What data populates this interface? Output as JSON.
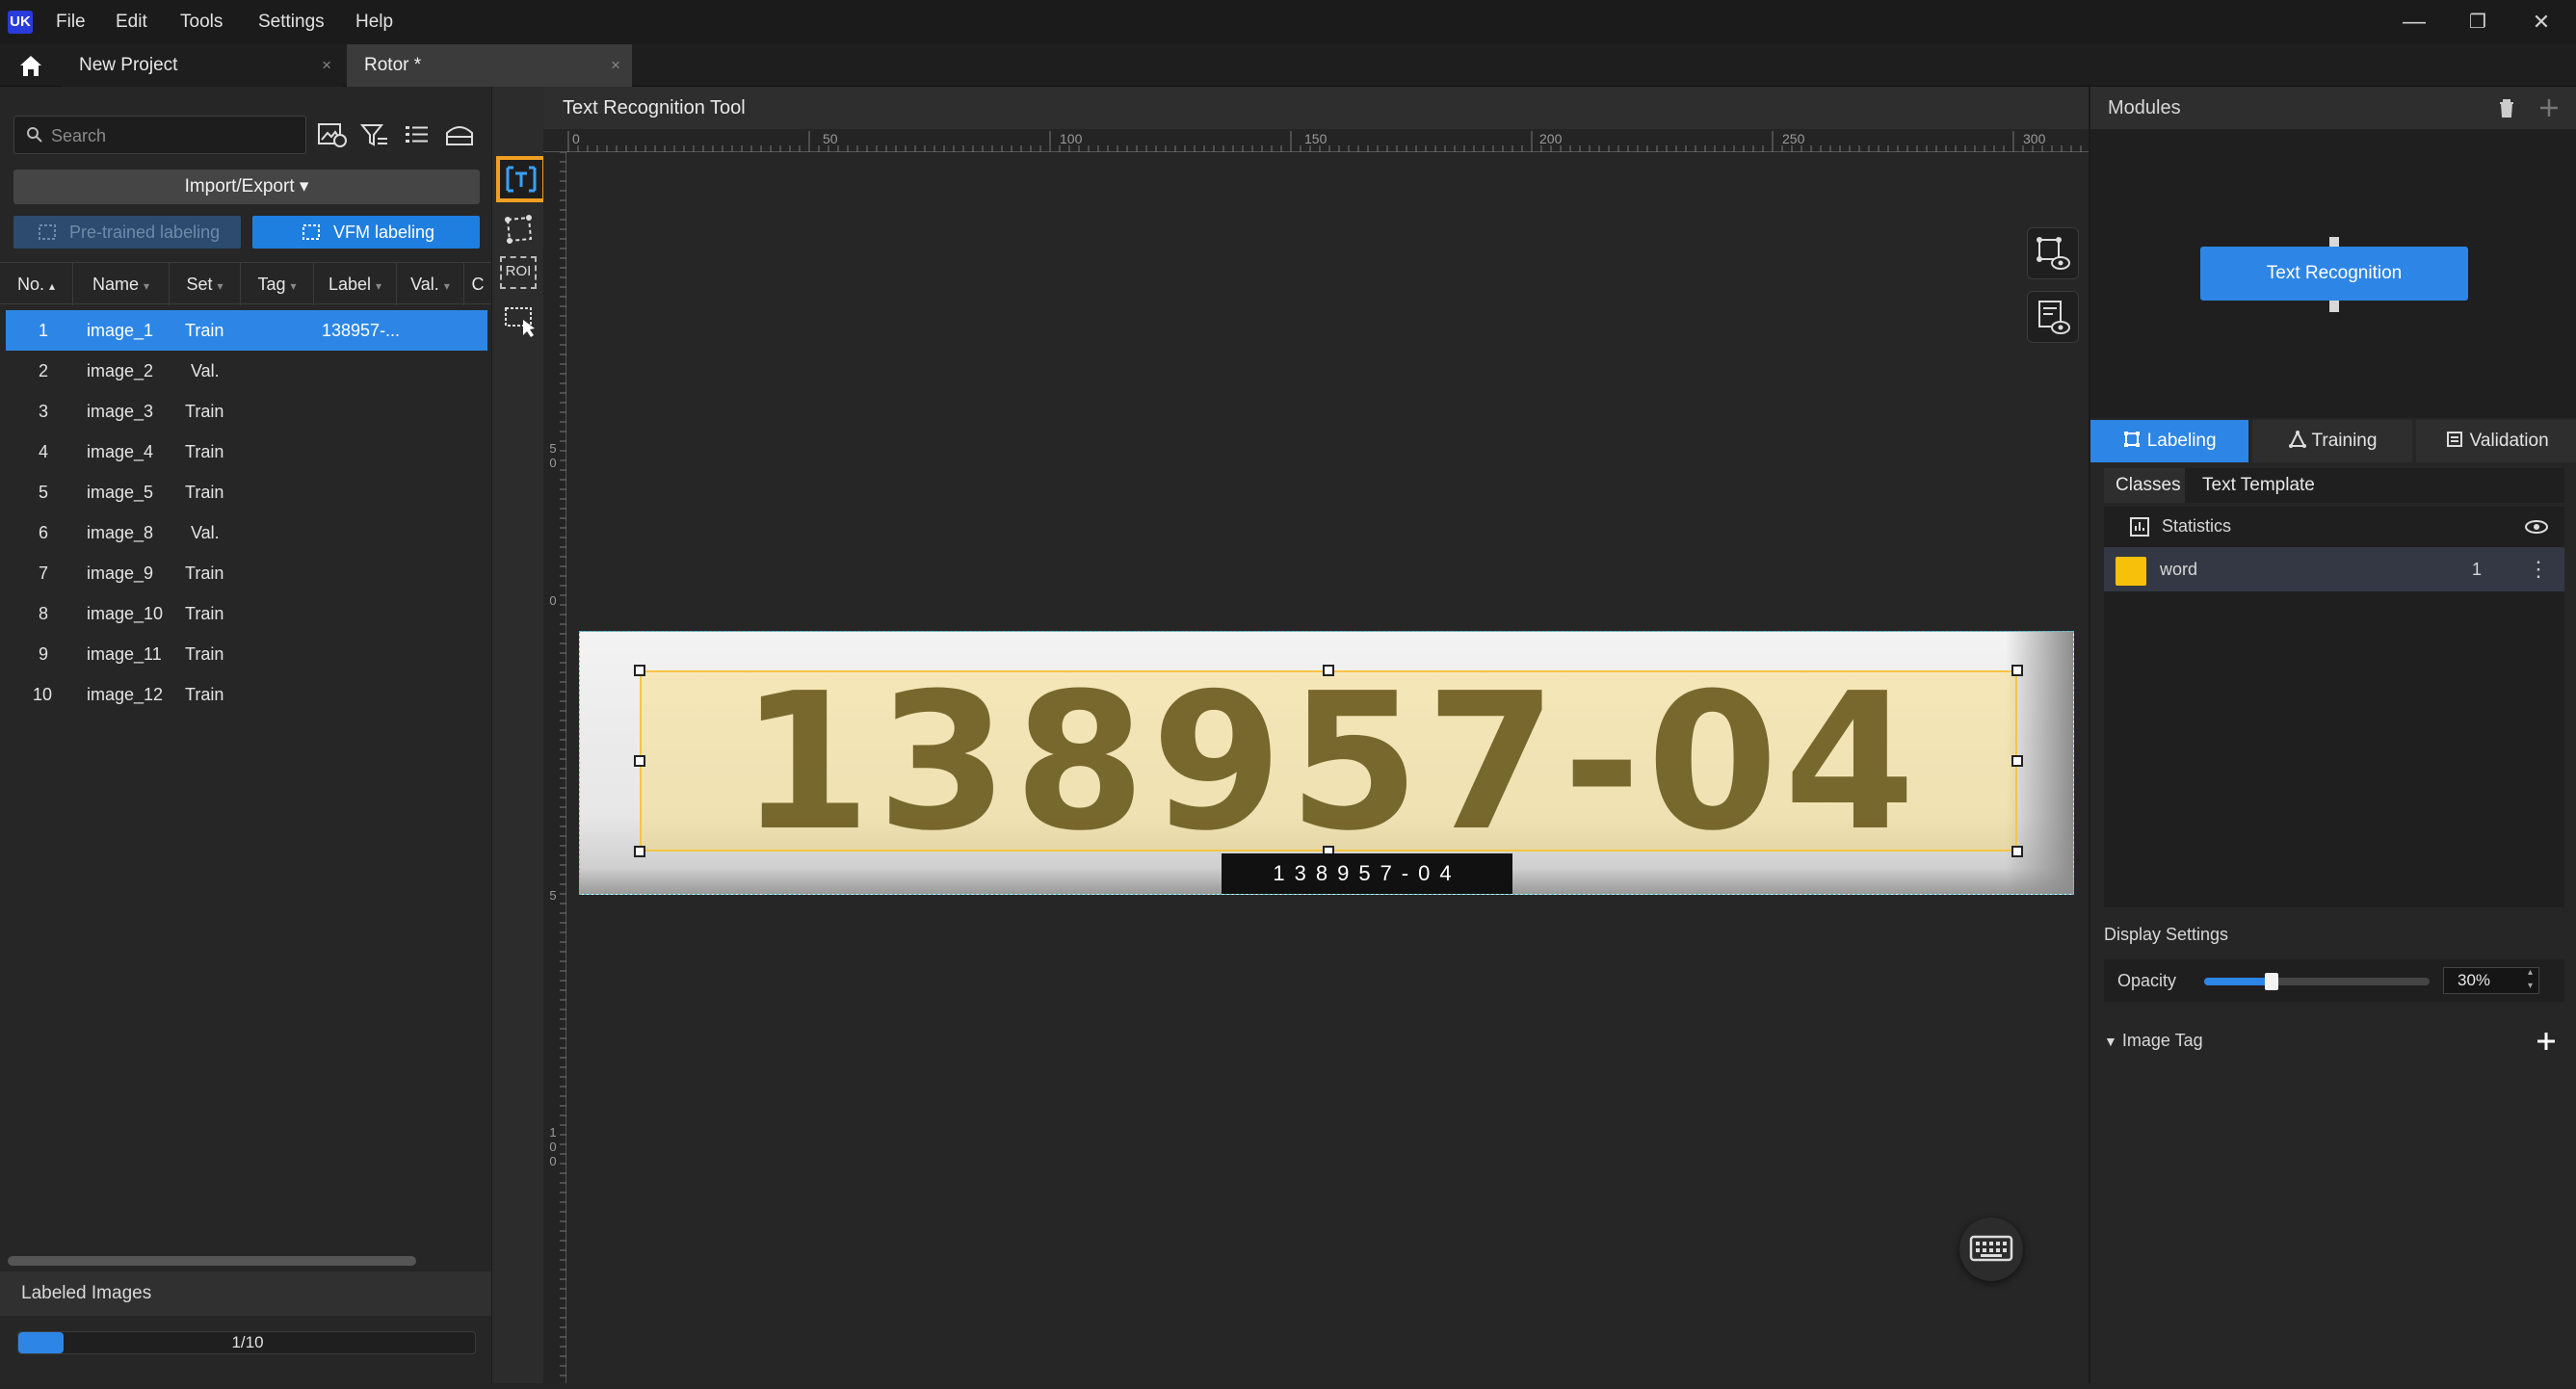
{
  "app": {
    "logo_text": "UK"
  },
  "menu": [
    "File",
    "Edit",
    "Tools",
    "Settings",
    "Help"
  ],
  "window_controls": {
    "minimize": "—",
    "restore": "❐",
    "close": "✕"
  },
  "tabs": [
    {
      "label": "New Project",
      "close": "×"
    },
    {
      "label": "Rotor *",
      "close": "×"
    }
  ],
  "left": {
    "search_placeholder": "Search",
    "import_export_label": "Import/Export",
    "import_export_caret": "▾",
    "pretrained_label": "Pre-trained labeling",
    "vfm_label": "VFM labeling",
    "columns": [
      "No.",
      "Name",
      "Set",
      "Tag",
      "Label",
      "Val.",
      "C"
    ],
    "rows": [
      {
        "no": "1",
        "name": "image_1",
        "set": "Train",
        "label": "138957-..."
      },
      {
        "no": "2",
        "name": "image_2",
        "set": "Val.",
        "label": ""
      },
      {
        "no": "3",
        "name": "image_3",
        "set": "Train",
        "label": ""
      },
      {
        "no": "4",
        "name": "image_4",
        "set": "Train",
        "label": ""
      },
      {
        "no": "5",
        "name": "image_5",
        "set": "Train",
        "label": ""
      },
      {
        "no": "6",
        "name": "image_8",
        "set": "Val.",
        "label": ""
      },
      {
        "no": "7",
        "name": "image_9",
        "set": "Train",
        "label": ""
      },
      {
        "no": "8",
        "name": "image_10",
        "set": "Train",
        "label": ""
      },
      {
        "no": "9",
        "name": "image_11",
        "set": "Train",
        "label": ""
      },
      {
        "no": "10",
        "name": "image_12",
        "set": "Train",
        "label": ""
      }
    ],
    "labeled_images_title": "Labeled Images",
    "labeled_progress_text": "1/10",
    "labeled_fraction": 0.1
  },
  "tools": {
    "roi_label": "ROI"
  },
  "canvas": {
    "title": "Text Recognition Tool",
    "ruler_top": [
      "0",
      "50",
      "100",
      "150",
      "200",
      "250",
      "300"
    ],
    "ruler_left": [
      "0",
      "5",
      "0",
      "5",
      "1 0 0"
    ],
    "image_text": "138957-04",
    "recognized_label": "138957-04"
  },
  "right": {
    "modules_title": "Modules",
    "module_node_label": "Text Recognition",
    "tabs": [
      "Labeling",
      "Training",
      "Validation"
    ],
    "subtabs": [
      "Classes",
      "Text Template"
    ],
    "statistics_label": "Statistics",
    "class_name": "word",
    "class_count": "1",
    "class_color": "#f7c10b",
    "display_settings_title": "Display Settings",
    "opacity_label": "Opacity",
    "opacity_value": "30%",
    "opacity_fraction": 0.3,
    "image_tag_label": "Image Tag"
  }
}
